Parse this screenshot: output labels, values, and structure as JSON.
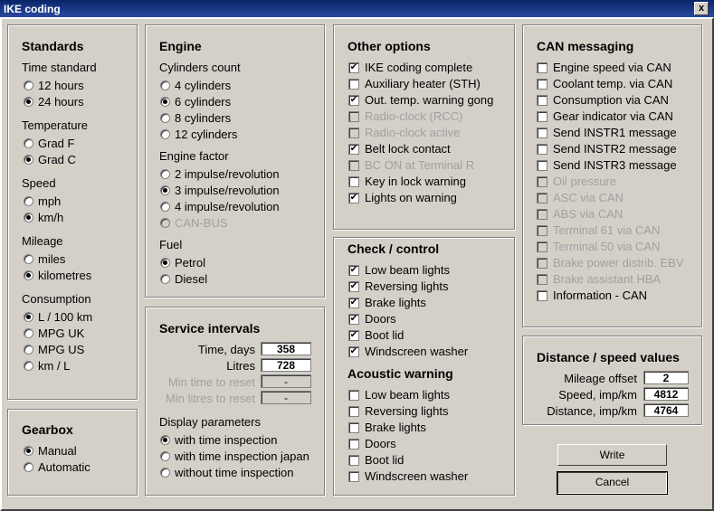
{
  "window": {
    "title": "IKE coding",
    "close_label": "x"
  },
  "standards": {
    "title": "Standards",
    "time": {
      "label": "Time standard",
      "options": [
        "12 hours",
        "24 hours"
      ]
    },
    "temperature": {
      "label": "Temperature",
      "options": [
        "Grad F",
        "Grad C"
      ]
    },
    "speed": {
      "label": "Speed",
      "options": [
        "mph",
        "km/h"
      ]
    },
    "mileage": {
      "label": "Mileage",
      "options": [
        "miles",
        "kilometres"
      ]
    },
    "consumption": {
      "label": "Consumption",
      "options": [
        "L / 100 km",
        "MPG UK",
        "MPG US",
        "km / L"
      ]
    }
  },
  "gearbox": {
    "title": "Gearbox",
    "options": [
      "Manual",
      "Automatic"
    ]
  },
  "engine": {
    "title": "Engine",
    "cylinders": {
      "label": "Cylinders count",
      "options": [
        "4 cylinders",
        "6 cylinders",
        "8 cylinders",
        "12 cylinders"
      ]
    },
    "factor": {
      "label": "Engine factor",
      "options": [
        "2 impulse/revolution",
        "3 impulse/revolution",
        "4 impulse/revolution",
        "CAN-BUS"
      ]
    },
    "fuel": {
      "label": "Fuel",
      "options": [
        "Petrol",
        "Diesel"
      ]
    }
  },
  "service": {
    "title": "Service intervals",
    "fields": [
      {
        "label": "Time, days",
        "value": "358"
      },
      {
        "label": "Litres",
        "value": "728"
      },
      {
        "label": "Min time to reset",
        "value": "-"
      },
      {
        "label": "Min litres to reset",
        "value": "-"
      }
    ],
    "display": {
      "label": "Display parameters",
      "options": [
        "with time inspection",
        "with time inspection japan",
        "without time inspection"
      ]
    }
  },
  "other": {
    "title": "Other options",
    "items": [
      "IKE coding complete",
      "Auxiliary heater (STH)",
      "Out. temp. warning gong",
      "Radio-clock (RCC)",
      "Radio-clock active",
      "Belt lock contact",
      "BC ON at Terminal R",
      "Key in lock warning",
      "Lights on warning"
    ]
  },
  "check": {
    "title": "Check / control",
    "items": [
      "Low beam lights",
      "Reversing lights",
      "Brake lights",
      "Doors",
      "Boot lid",
      "Windscreen washer"
    ],
    "acoustic_title": "Acoustic warning",
    "acoustic_items": [
      "Low beam lights",
      "Reversing lights",
      "Brake lights",
      "Doors",
      "Boot lid",
      "Windscreen washer"
    ]
  },
  "can": {
    "title": "CAN messaging",
    "items": [
      "Engine speed via CAN",
      "Coolant temp. via CAN",
      "Consumption via CAN",
      "Gear indicator via CAN",
      "Send INSTR1 message",
      "Send INSTR2 message",
      "Send INSTR3 message",
      "Oil pressure",
      "ASC via CAN",
      "ABS via CAN",
      "Terminal 61 via CAN",
      "Terminal 50 via CAN",
      "Brake power distrib. EBV",
      "Brake assistant HBA",
      "Information - CAN"
    ]
  },
  "distance": {
    "title": "Distance / speed values",
    "fields": [
      {
        "label": "Mileage offset",
        "value": "2"
      },
      {
        "label": "Speed, imp/km",
        "value": "4812"
      },
      {
        "label": "Distance, imp/km",
        "value": "4764"
      }
    ]
  },
  "buttons": {
    "write": "Write",
    "cancel": "Cancel"
  },
  "icons": {
    "checkbox_check": "check-mark-icon",
    "radio_dot": "radio-dot-icon",
    "close": "close-icon"
  }
}
